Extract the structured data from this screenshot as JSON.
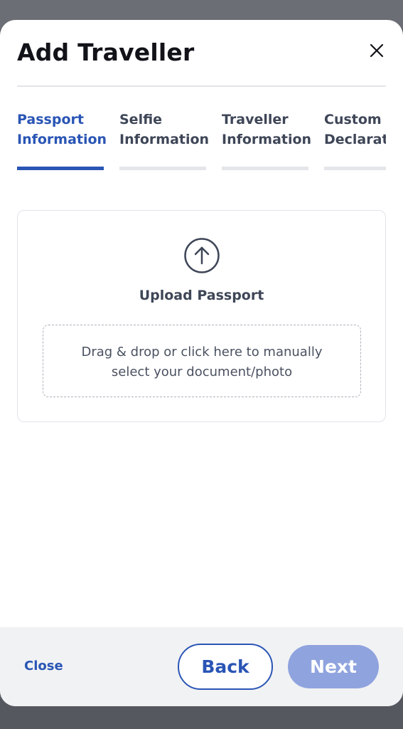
{
  "modal": {
    "title": "Add Traveller",
    "close_icon": "close-icon"
  },
  "tabs": [
    {
      "label": "Passport\nInformation",
      "active": true
    },
    {
      "label": "Selfie\nInformation",
      "active": false
    },
    {
      "label": "Traveller\nInformation",
      "active": false
    },
    {
      "label": "Custom\nDeclaration",
      "active": false
    }
  ],
  "upload": {
    "icon": "upload-arrow-icon",
    "title": "Upload Passport",
    "dropzone_text": "Drag & drop or click here to manually\nselect your document/photo"
  },
  "footer": {
    "close_label": "Close",
    "back_label": "Back",
    "next_label": "Next"
  },
  "colors": {
    "accent": "#2a55b5",
    "next_disabled": "#8fa3de",
    "text_dark": "#111318",
    "text_muted": "#3e4657",
    "tab_inactive_bar": "#e5e6ea",
    "footer_bg": "#f1f2f4"
  }
}
